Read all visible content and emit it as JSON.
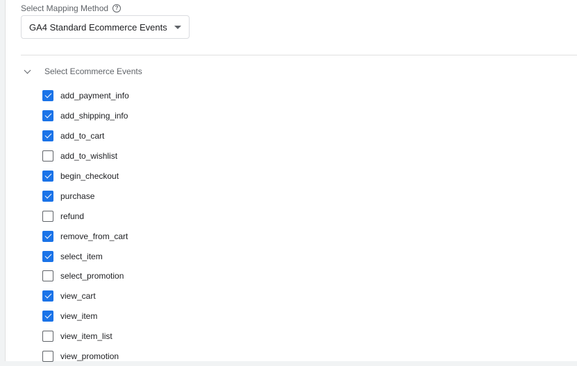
{
  "mapping": {
    "label": "Select Mapping Method",
    "help_icon": "?",
    "selected": "GA4 Standard Ecommerce Events"
  },
  "events_section": {
    "title": "Select Ecommerce Events",
    "items": [
      {
        "label": "add_payment_info",
        "checked": true
      },
      {
        "label": "add_shipping_info",
        "checked": true
      },
      {
        "label": "add_to_cart",
        "checked": true
      },
      {
        "label": "add_to_wishlist",
        "checked": false
      },
      {
        "label": "begin_checkout",
        "checked": true
      },
      {
        "label": "purchase",
        "checked": true
      },
      {
        "label": "refund",
        "checked": false
      },
      {
        "label": "remove_from_cart",
        "checked": true
      },
      {
        "label": "select_item",
        "checked": true
      },
      {
        "label": "select_promotion",
        "checked": false
      },
      {
        "label": "view_cart",
        "checked": true
      },
      {
        "label": "view_item",
        "checked": true
      },
      {
        "label": "view_item_list",
        "checked": false
      },
      {
        "label": "view_promotion",
        "checked": false
      }
    ]
  },
  "colors": {
    "accent": "#1a73e8",
    "label_gray": "#5f6368",
    "text": "#202124"
  }
}
